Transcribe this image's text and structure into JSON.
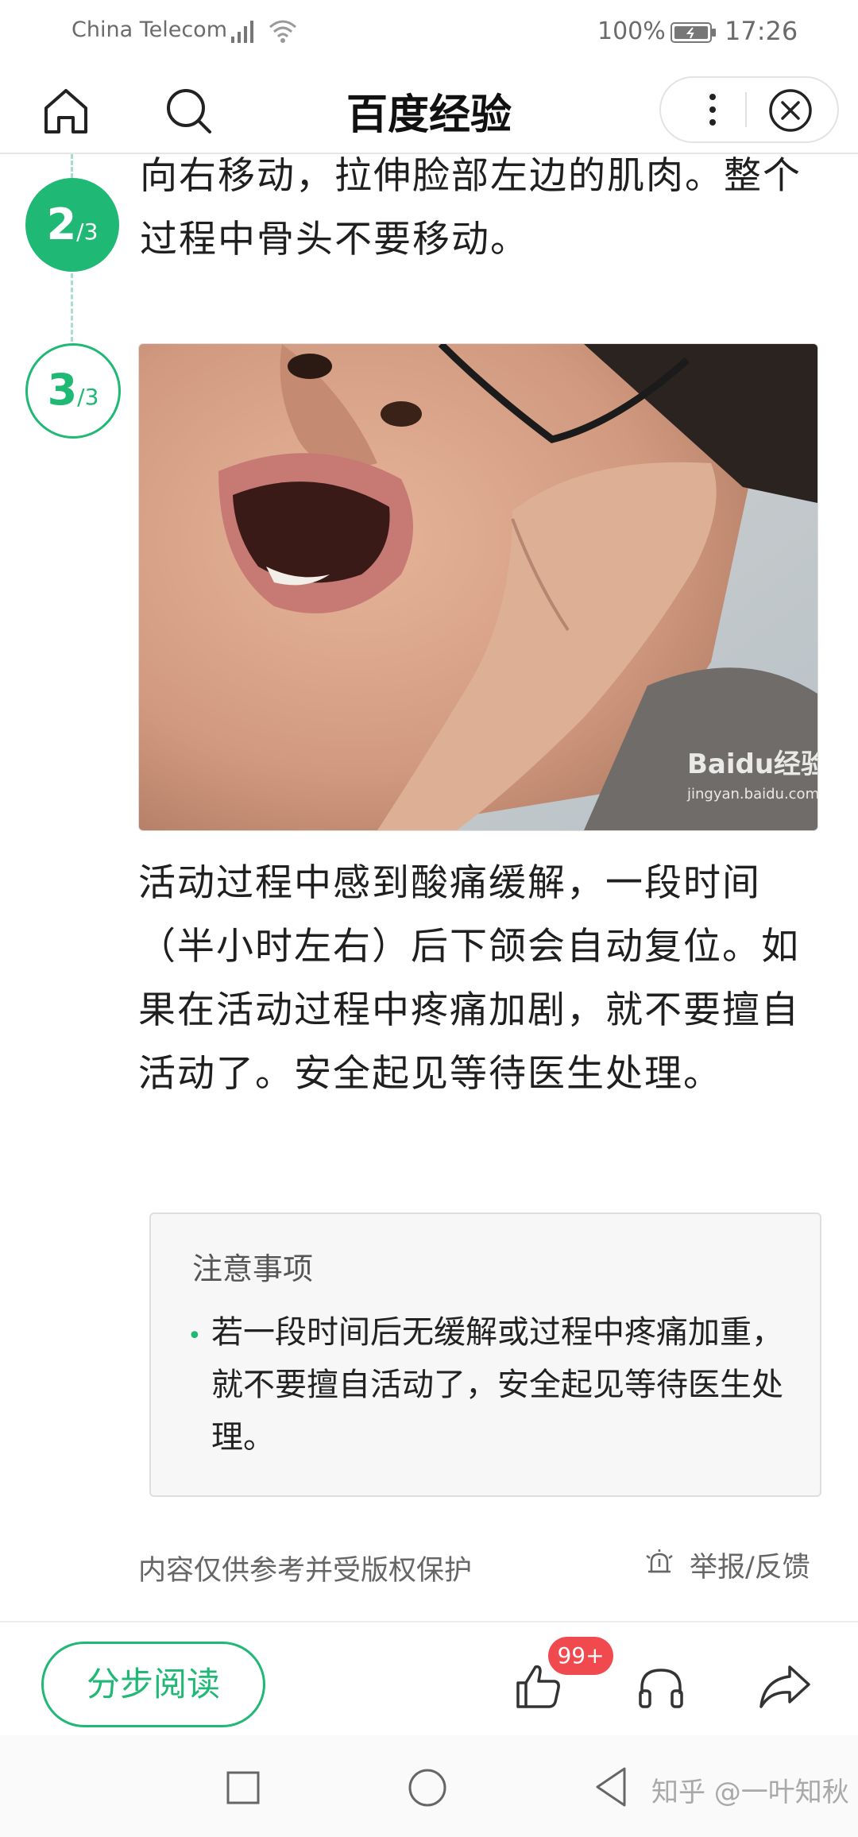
{
  "status_bar": {
    "carrier": "China Telecom",
    "battery": "100%",
    "time": "17:26"
  },
  "header": {
    "title": "百度经验"
  },
  "steps": [
    {
      "number": "2",
      "total": "/3",
      "text": "向右移动，拉伸脸部左边的肌肉。整个过程中骨头不要移动。"
    },
    {
      "number": "3",
      "total": "/3",
      "text": "活动过程中感到酸痛缓解，一段时间（半小时左右）后下颌会自动复位。如果在活动过程中疼痛加剧，就不要擅自活动了。安全起见等待医生处理。",
      "image_watermark": "Baidu经验",
      "image_watermark_url": "jingyan.baidu.com"
    }
  ],
  "notice": {
    "title": "注意事项",
    "bullet": "•",
    "text": "若一段时间后无缓解或过程中疼痛加重，就不要擅自活动了，安全起见等待医生处理。"
  },
  "footer": {
    "copyright": "内容仅供参考并受版权保护",
    "report": "举报/反馈"
  },
  "action_bar": {
    "read_label": "分步阅读",
    "like_badge": "99+"
  },
  "watermark": "知乎 @一叶知秋",
  "colors": {
    "accent": "#1fb874",
    "badge": "#f04a4f"
  },
  "icons": [
    "home-icon",
    "search-icon",
    "more-icon",
    "close-icon",
    "thumb-up-icon",
    "headphones-icon",
    "share-icon",
    "report-icon"
  ]
}
